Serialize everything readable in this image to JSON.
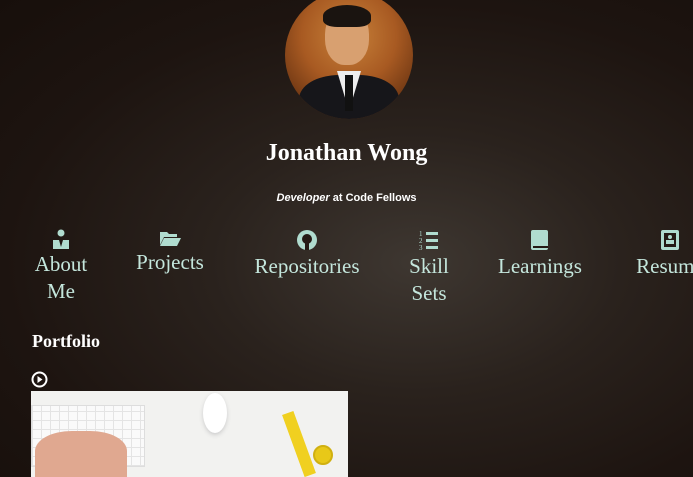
{
  "profile": {
    "name": "Jonathan Wong",
    "role": "Developer",
    "at": " at Code Fellows"
  },
  "nav": [
    {
      "label": "About Me",
      "icon": "user-tie-icon"
    },
    {
      "label": "Projects",
      "icon": "folder-open-icon"
    },
    {
      "label": "Repositories",
      "icon": "github-icon"
    },
    {
      "label": "Skill Sets",
      "icon": "ordered-list-icon"
    },
    {
      "label": "Learnings",
      "icon": "book-icon"
    },
    {
      "label": "Resume",
      "icon": "contact-card-icon"
    }
  ],
  "portfolio": {
    "title": "Portfolio",
    "icon": "play-circle-icon"
  },
  "colors": {
    "accent": "#c4e6dc",
    "background": "#1d1410"
  }
}
